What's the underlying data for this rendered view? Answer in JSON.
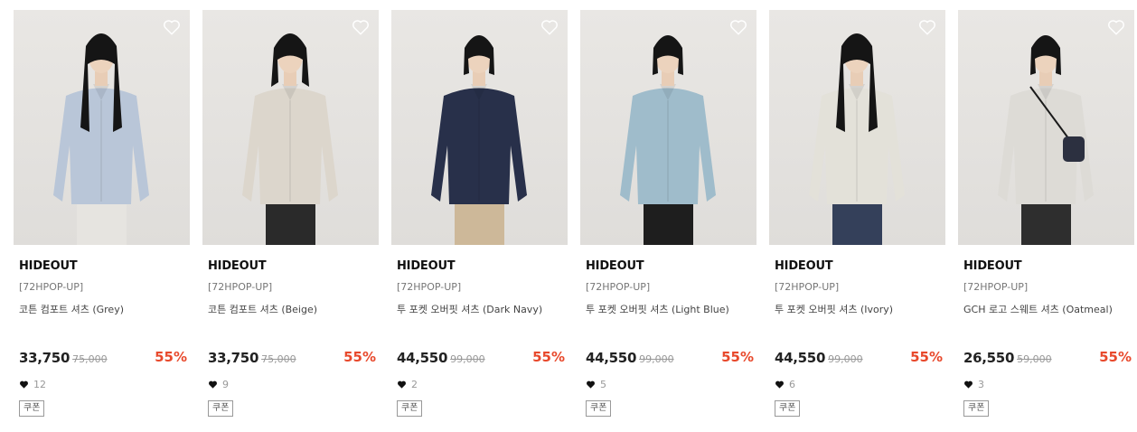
{
  "products": [
    {
      "brand": "HIDEOUT",
      "tag": "[72HPOP-UP]",
      "name": "코튼 컴포트 셔츠 (Grey)",
      "price": "33,750",
      "original_price": "75,000",
      "discount": "55%",
      "likes": "12",
      "coupon": "쿠폰",
      "shirt_color": "#b9c6d8",
      "pants_color": "#e6e4e0",
      "hair": "long",
      "bag": false
    },
    {
      "brand": "HIDEOUT",
      "tag": "[72HPOP-UP]",
      "name": "코튼 컴포트 셔츠 (Beige)",
      "price": "33,750",
      "original_price": "75,000",
      "discount": "55%",
      "likes": "9",
      "coupon": "쿠폰",
      "shirt_color": "#dcd6cc",
      "pants_color": "#2a2a2a",
      "hair": "medium",
      "bag": false
    },
    {
      "brand": "HIDEOUT",
      "tag": "[72HPOP-UP]",
      "name": "투 포켓 오버핏 셔츠 (Dark Navy)",
      "price": "44,550",
      "original_price": "99,000",
      "discount": "55%",
      "likes": "2",
      "coupon": "쿠폰",
      "shirt_color": "#28304a",
      "pants_color": "#cdb899",
      "hair": "bob",
      "bag": false
    },
    {
      "brand": "HIDEOUT",
      "tag": "[72HPOP-UP]",
      "name": "투 포켓 오버핏 셔츠 (Light Blue)",
      "price": "44,550",
      "original_price": "99,000",
      "discount": "55%",
      "likes": "5",
      "coupon": "쿠폰",
      "shirt_color": "#9fbccb",
      "pants_color": "#1e1e1e",
      "hair": "bob",
      "bag": false
    },
    {
      "brand": "HIDEOUT",
      "tag": "[72HPOP-UP]",
      "name": "투 포켓 오버핏 셔츠 (Ivory)",
      "price": "44,550",
      "original_price": "99,000",
      "discount": "55%",
      "likes": "6",
      "coupon": "쿠폰",
      "shirt_color": "#e3e1d9",
      "pants_color": "#34405a",
      "hair": "long",
      "bag": false
    },
    {
      "brand": "HIDEOUT",
      "tag": "[72HPOP-UP]",
      "name": "GCH 로고 스웨트 셔츠 (Oatmeal)",
      "price": "26,550",
      "original_price": "59,000",
      "discount": "55%",
      "likes": "3",
      "coupon": "쿠폰",
      "shirt_color": "#dddbd6",
      "pants_color": "#2e2e2e",
      "hair": "bob",
      "bag": true
    }
  ],
  "colors": {
    "discount": "#e8492c",
    "brand_text": "#111111",
    "photo_bg": "#e5e3e0"
  },
  "icons": {
    "wishlist": "heart-outline-icon",
    "likes": "heart-filled-icon"
  }
}
